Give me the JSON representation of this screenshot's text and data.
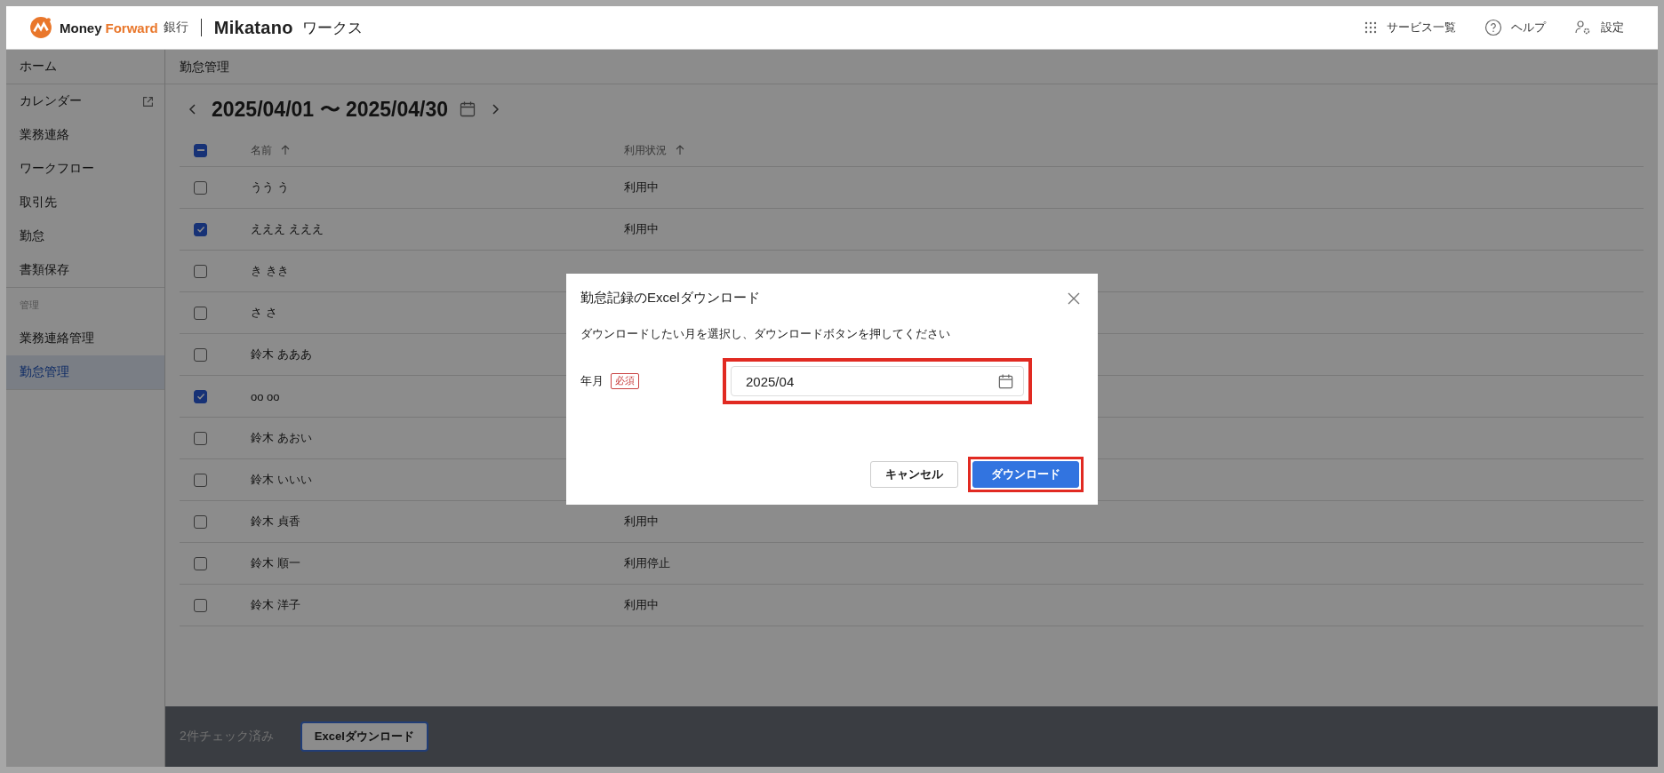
{
  "logo": {
    "company": "Money",
    "company_accent": "Forward",
    "company_suffix": "銀行",
    "product": "Mikatano",
    "product_suffix": "ワークス"
  },
  "header_links": [
    {
      "kind": "grid",
      "label": "サービス一覧"
    },
    {
      "kind": "help",
      "label": "ヘルプ"
    },
    {
      "kind": "settings",
      "label": "設定"
    }
  ],
  "sidebar": {
    "items": [
      {
        "kind": "item",
        "label": "ホーム",
        "selected": false,
        "external": false,
        "divider_after": true
      },
      {
        "kind": "item",
        "label": "カレンダー",
        "selected": false,
        "external": true,
        "divider_after": false
      },
      {
        "kind": "item",
        "label": "業務連絡",
        "selected": false,
        "external": false,
        "divider_after": false
      },
      {
        "kind": "item",
        "label": "ワークフロー",
        "selected": false,
        "external": false,
        "divider_after": false
      },
      {
        "kind": "item",
        "label": "取引先",
        "selected": false,
        "external": false,
        "divider_after": false
      },
      {
        "kind": "item",
        "label": "勤怠",
        "selected": false,
        "external": false,
        "divider_after": false
      },
      {
        "kind": "item",
        "label": "書類保存",
        "selected": false,
        "external": false,
        "divider_after": true
      },
      {
        "kind": "section",
        "label": "管理"
      },
      {
        "kind": "item",
        "label": "業務連絡管理",
        "selected": false,
        "external": false,
        "divider_after": false
      },
      {
        "kind": "item",
        "label": "勤怠管理",
        "selected": true,
        "external": false,
        "divider_after": true
      }
    ]
  },
  "page_title": "勤怠管理",
  "date_range": "2025/04/01 〜 2025/04/30",
  "table": {
    "select_all": {
      "partial": true
    },
    "columns": [
      {
        "label": "名前",
        "sorted": true
      },
      {
        "label": "利用状況",
        "sorted": true
      }
    ],
    "rows": [
      {
        "name": "うう う",
        "status": "利用中",
        "checked": false
      },
      {
        "name": "えええ えええ",
        "status": "利用中",
        "checked": true
      },
      {
        "name": "き きき",
        "checked": false
      },
      {
        "name": "さ さ",
        "checked": false
      },
      {
        "name": "鈴木 あああ",
        "checked": false
      },
      {
        "name": "oo oo",
        "checked": true
      },
      {
        "name": "鈴木 あおい",
        "checked": false
      },
      {
        "name": "鈴木 いいい",
        "checked": false
      },
      {
        "name": "鈴木 貞香",
        "status": "利用中",
        "checked": false
      },
      {
        "name": "鈴木 順一",
        "status": "利用停止",
        "checked": false
      },
      {
        "name": "鈴木 洋子",
        "status": "利用中",
        "checked": false
      }
    ]
  },
  "bottom_bar": {
    "count": "2件チェック済み",
    "button": "Excelダウンロード",
    "focused": true
  },
  "dialog": {
    "title": "勤怠記録のExcelダウンロード",
    "message": "ダウンロードしたい月を選択し、ダウンロードボタンを押してください",
    "field": {
      "label": "年月",
      "badge": "必須",
      "value": "2025/04",
      "highlighted": true
    },
    "buttons": [
      {
        "kind": "secondary",
        "label": "キャンセル",
        "highlighted": false
      },
      {
        "kind": "primary",
        "label": "ダウンロード",
        "highlighted": true
      }
    ]
  }
}
